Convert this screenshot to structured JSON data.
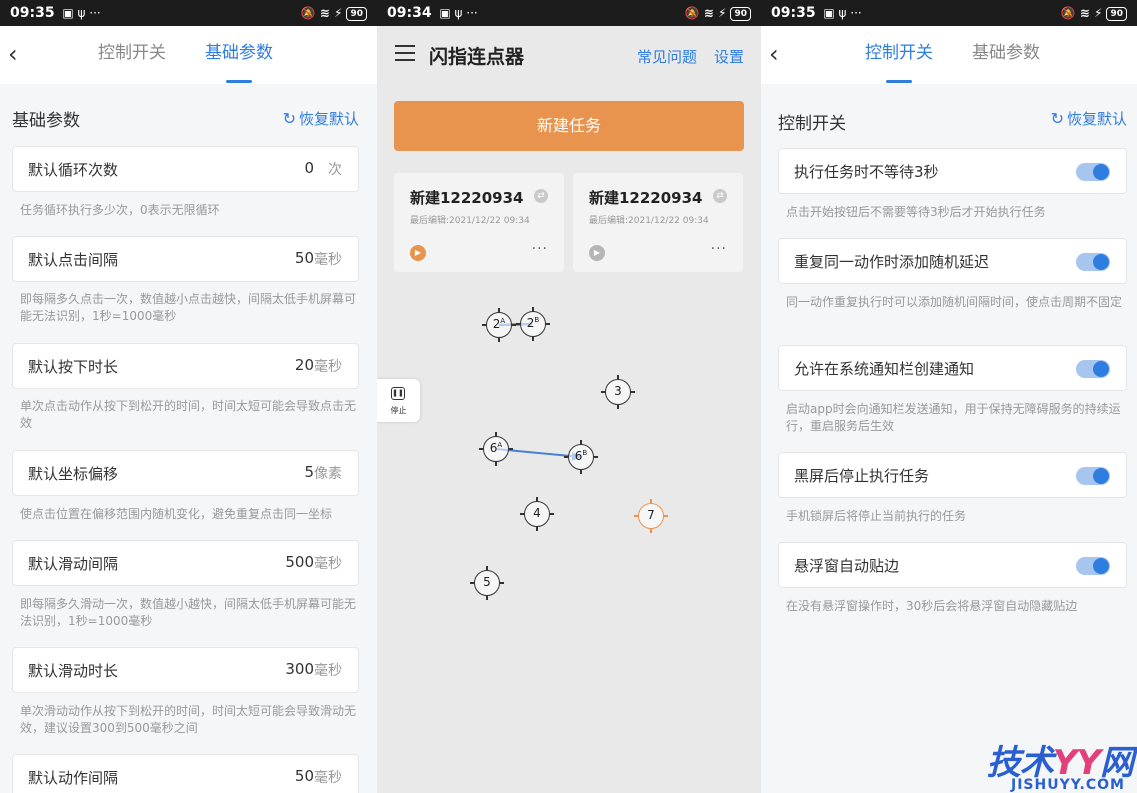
{
  "status_left": {
    "time_left": "09:35",
    "time_middle": "09:34",
    "time_right": "09:35",
    "battery": "90"
  },
  "left_screen": {
    "tabs": [
      "控制开关",
      "基础参数"
    ],
    "section_title": "基础参数",
    "reset_label": "恢复默认",
    "params": [
      {
        "label": "默认循环次数",
        "value": "0",
        "unit": "次",
        "desc": "任务循环执行多少次，0表示无限循环"
      },
      {
        "label": "默认点击间隔",
        "value": "50",
        "unit": "毫秒",
        "desc": "即每隔多久点击一次，数值越小点击越快，间隔太低手机屏幕可能无法识别，1秒=1000毫秒"
      },
      {
        "label": "默认按下时长",
        "value": "20",
        "unit": "毫秒",
        "desc": "单次点击动作从按下到松开的时间，时间太短可能会导致点击无效"
      },
      {
        "label": "默认坐标偏移",
        "value": "5",
        "unit": "像素",
        "desc": "使点击位置在偏移范围内随机变化，避免重复点击同一坐标"
      },
      {
        "label": "默认滑动间隔",
        "value": "500",
        "unit": "毫秒",
        "desc": "即每隔多久滑动一次，数值越小越快，间隔太低手机屏幕可能无法识别，1秒=1000毫秒"
      },
      {
        "label": "默认滑动时长",
        "value": "300",
        "unit": "毫秒",
        "desc": "单次滑动动作从按下到松开的时间，时间太短可能会导致滑动无效，建议设置300到500毫秒之间"
      },
      {
        "label": "默认动作间隔",
        "value": "50",
        "unit": "毫秒",
        "desc": ""
      }
    ]
  },
  "middle_screen": {
    "app_title": "闪指连点器",
    "faq_link": "常见问题",
    "settings_link": "设置",
    "new_task_button": "新建任务",
    "tasks": [
      {
        "name": "新建12220934",
        "meta": "最后编辑:2021/12/22 09:34",
        "play_color": "#e8944e",
        "more": "···"
      },
      {
        "name": "新建12220934",
        "meta": "最后编辑:2021/12/22 09:34",
        "play_color": "#b5b5b5",
        "more": "···"
      }
    ],
    "float_stop_label": "停止",
    "points": [
      {
        "label": "2",
        "sup": "A"
      },
      {
        "label": "2",
        "sup": "B"
      },
      {
        "label": "3",
        "sup": ""
      },
      {
        "label": "6",
        "sup": "A"
      },
      {
        "label": "6",
        "sup": "B"
      },
      {
        "label": "4",
        "sup": ""
      },
      {
        "label": "7",
        "sup": "",
        "color": "#e8944e"
      },
      {
        "label": "5",
        "sup": ""
      }
    ],
    "swipe_color": "#4a7fd6"
  },
  "right_screen": {
    "tabs": [
      "控制开关",
      "基础参数"
    ],
    "section_title": "控制开关",
    "reset_label": "恢复默认",
    "switches": [
      {
        "label": "执行任务时不等待3秒",
        "on": true,
        "desc": "点击开始按钮后不需要等待3秒后才开始执行任务"
      },
      {
        "label": "重复同一动作时添加随机延迟",
        "on": true,
        "desc": "同一动作重复执行时可以添加随机间隔时间，使点击周期不固定"
      },
      {
        "label": "允许在系统通知栏创建通知",
        "on": true,
        "desc": "启动app时会向通知栏发送通知，用于保持无障碍服务的持续运行，重启服务后生效"
      },
      {
        "label": "黑屏后停止执行任务",
        "on": true,
        "desc": "手机锁屏后将停止当前执行的任务"
      },
      {
        "label": "悬浮窗自动贴边",
        "on": true,
        "desc": "在没有悬浮窗操作时，30秒后会将悬浮窗自动隐藏贴边"
      }
    ]
  },
  "watermark": {
    "main_a": "技术",
    "main_b": "YY",
    "main_c": "网",
    "sub": "JISHUYY.COM"
  },
  "colors": {
    "accent": "#2f7de1",
    "orange": "#e8944e"
  }
}
